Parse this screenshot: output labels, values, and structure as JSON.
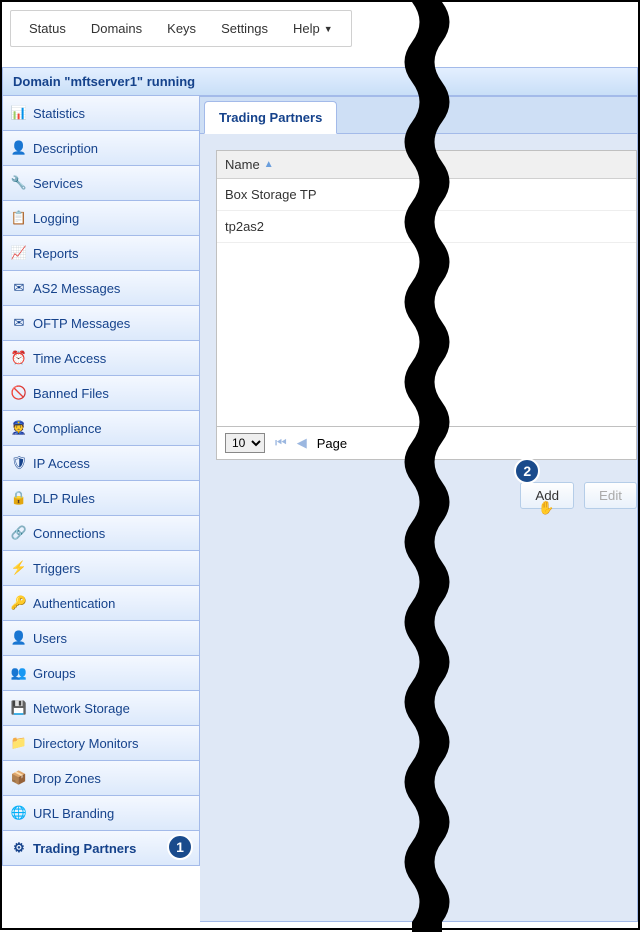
{
  "top_menu": {
    "status": "Status",
    "domains": "Domains",
    "keys": "Keys",
    "settings": "Settings",
    "help": "Help"
  },
  "domain_bar": "Domain \"mftserver1\" running",
  "sidebar": {
    "items": [
      {
        "label": "Statistics",
        "icon": "📊"
      },
      {
        "label": "Description",
        "icon": "👤"
      },
      {
        "label": "Services",
        "icon": "🔧"
      },
      {
        "label": "Logging",
        "icon": "📋"
      },
      {
        "label": "Reports",
        "icon": "📈"
      },
      {
        "label": "AS2 Messages",
        "icon": "✉"
      },
      {
        "label": "OFTP Messages",
        "icon": "✉"
      },
      {
        "label": "Time Access",
        "icon": "⏰"
      },
      {
        "label": "Banned Files",
        "icon": "🚫"
      },
      {
        "label": "Compliance",
        "icon": "👮"
      },
      {
        "label": "IP Access",
        "icon": "🛡"
      },
      {
        "label": "DLP Rules",
        "icon": "🔒"
      },
      {
        "label": "Connections",
        "icon": "🔗"
      },
      {
        "label": "Triggers",
        "icon": "⚡"
      },
      {
        "label": "Authentication",
        "icon": "🔑"
      },
      {
        "label": "Users",
        "icon": "👤"
      },
      {
        "label": "Groups",
        "icon": "👥"
      },
      {
        "label": "Network Storage",
        "icon": "💾"
      },
      {
        "label": "Directory Monitors",
        "icon": "📁"
      },
      {
        "label": "Drop Zones",
        "icon": "📦"
      },
      {
        "label": "URL Branding",
        "icon": "🌐"
      },
      {
        "label": "Trading Partners",
        "icon": "⚙"
      }
    ]
  },
  "tab": {
    "label": "Trading Partners"
  },
  "grid": {
    "header": "Name",
    "rows": [
      "Box Storage TP",
      "tp2as2"
    ]
  },
  "pager": {
    "page_size": "10",
    "page_label": "Page"
  },
  "buttons": {
    "add": "Add",
    "edit": "Edit"
  },
  "callouts": {
    "one": "1",
    "two": "2"
  }
}
